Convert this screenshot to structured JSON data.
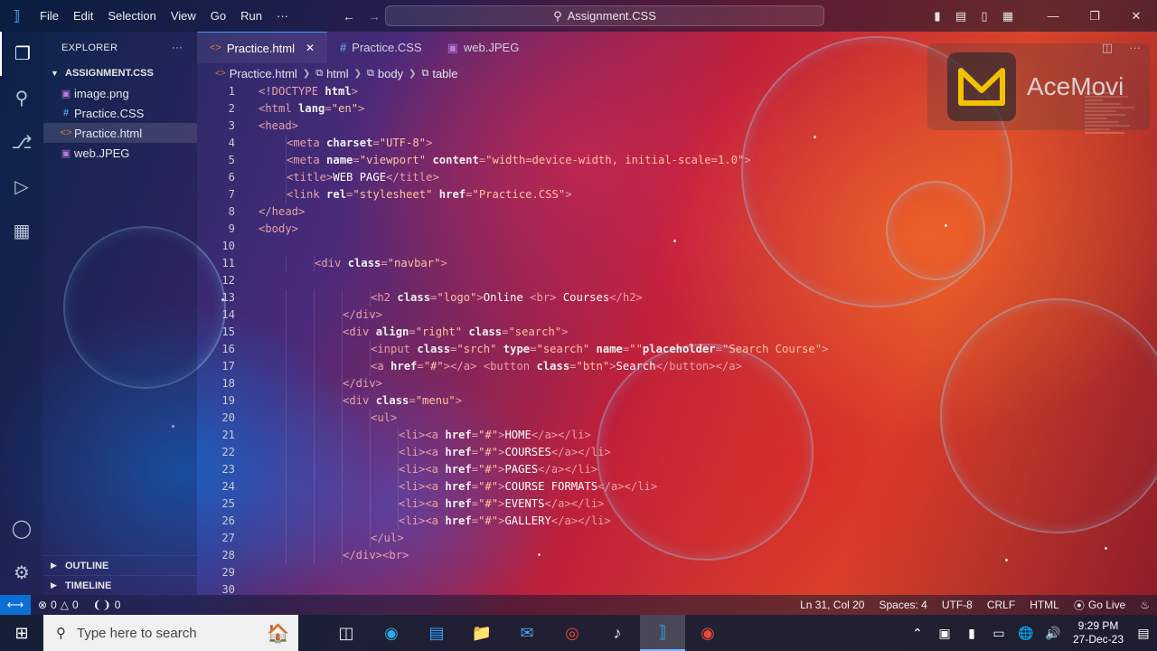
{
  "titlebar": {
    "menu": [
      "File",
      "Edit",
      "Selection",
      "View",
      "Go",
      "Run",
      "···"
    ],
    "search_text": "Assignment.CSS"
  },
  "sidebar": {
    "header": "EXPLORER",
    "more": "···",
    "folder": "ASSIGNMENT.CSS",
    "files": [
      {
        "name": "image.png",
        "icon": "image-file-icon"
      },
      {
        "name": "Practice.CSS",
        "icon": "css-file-icon"
      },
      {
        "name": "Practice.html",
        "icon": "html-file-icon"
      },
      {
        "name": "web.JPEG",
        "icon": "image-file-icon"
      }
    ],
    "outline": "OUTLINE",
    "timeline": "TIMELINE"
  },
  "tabs": [
    {
      "label": "Practice.html",
      "active": true
    },
    {
      "label": "Practice.CSS",
      "active": false
    },
    {
      "label": "web.JPEG",
      "active": false
    }
  ],
  "breadcrumb": [
    "Practice.html",
    "html",
    "body",
    "table"
  ],
  "code_lines": [
    {
      "n": "1",
      "indent": 0,
      "tokens": [
        [
          "tag",
          "<!DOCTYPE "
        ],
        [
          "attr",
          "html"
        ],
        [
          "tag",
          ">"
        ]
      ]
    },
    {
      "n": "2",
      "indent": 0,
      "tokens": [
        [
          "tag",
          "<html "
        ],
        [
          "attr",
          "lang"
        ],
        [
          "tag",
          "="
        ],
        [
          "str",
          "\"en\""
        ],
        [
          "tag",
          ">"
        ]
      ]
    },
    {
      "n": "3",
      "indent": 0,
      "tokens": [
        [
          "tag",
          "<head>"
        ]
      ]
    },
    {
      "n": "4",
      "indent": 1,
      "tokens": [
        [
          "tag",
          "<meta "
        ],
        [
          "attr",
          "charset"
        ],
        [
          "tag",
          "="
        ],
        [
          "str",
          "\"UTF-8\""
        ],
        [
          "tag",
          ">"
        ]
      ]
    },
    {
      "n": "5",
      "indent": 1,
      "tokens": [
        [
          "tag",
          "<meta "
        ],
        [
          "attr",
          "name"
        ],
        [
          "tag",
          "="
        ],
        [
          "str",
          "\"viewport\" "
        ],
        [
          "attr",
          "content"
        ],
        [
          "tag",
          "="
        ],
        [
          "str",
          "\"width=device-width, initial-scale=1.0\""
        ],
        [
          "tag",
          ">"
        ]
      ]
    },
    {
      "n": "6",
      "indent": 1,
      "tokens": [
        [
          "tag",
          "<title>"
        ],
        [
          "txt",
          "WEB PAGE"
        ],
        [
          "tag",
          "</title>"
        ]
      ]
    },
    {
      "n": "7",
      "indent": 1,
      "tokens": [
        [
          "tag",
          "<link "
        ],
        [
          "attr",
          "rel"
        ],
        [
          "tag",
          "="
        ],
        [
          "str",
          "\"stylesheet\" "
        ],
        [
          "attr",
          "href"
        ],
        [
          "tag",
          "="
        ],
        [
          "str",
          "\"Practice.CSS\""
        ],
        [
          "tag",
          ">"
        ]
      ]
    },
    {
      "n": "8",
      "indent": 0,
      "tokens": [
        [
          "tag",
          "</head>"
        ]
      ]
    },
    {
      "n": "9",
      "indent": 0,
      "tokens": [
        [
          "tag",
          "<body>"
        ]
      ]
    },
    {
      "n": "10",
      "indent": 0,
      "tokens": []
    },
    {
      "n": "11",
      "indent": 2,
      "tokens": [
        [
          "tag",
          "<div "
        ],
        [
          "attr",
          "class"
        ],
        [
          "tag",
          "="
        ],
        [
          "str",
          "\"navbar\""
        ],
        [
          "tag",
          ">"
        ]
      ]
    },
    {
      "n": "12",
      "indent": 0,
      "tokens": []
    },
    {
      "n": "13",
      "indent": 4,
      "tokens": [
        [
          "tag",
          "<h2 "
        ],
        [
          "attr",
          "class"
        ],
        [
          "tag",
          "="
        ],
        [
          "str",
          "\"logo\""
        ],
        [
          "tag",
          ">"
        ],
        [
          "txt",
          "Online "
        ],
        [
          "tag",
          "<br> "
        ],
        [
          "txt",
          "Courses"
        ],
        [
          "tag",
          "</h2>"
        ]
      ]
    },
    {
      "n": "14",
      "indent": 3,
      "tokens": [
        [
          "tag",
          "</div>"
        ]
      ]
    },
    {
      "n": "15",
      "indent": 3,
      "tokens": [
        [
          "tag",
          "<div "
        ],
        [
          "attr",
          "align"
        ],
        [
          "tag",
          "="
        ],
        [
          "str",
          "\"right\" "
        ],
        [
          "attr",
          "class"
        ],
        [
          "tag",
          "="
        ],
        [
          "str",
          "\"search\""
        ],
        [
          "tag",
          ">"
        ]
      ]
    },
    {
      "n": "16",
      "indent": 4,
      "tokens": [
        [
          "tag",
          "<input "
        ],
        [
          "attr",
          "class"
        ],
        [
          "tag",
          "="
        ],
        [
          "str",
          "\"srch\" "
        ],
        [
          "attr",
          "type"
        ],
        [
          "tag",
          "="
        ],
        [
          "str",
          "\"search\" "
        ],
        [
          "attr",
          "name"
        ],
        [
          "tag",
          "="
        ],
        [
          "str",
          "\"\""
        ],
        [
          "attr",
          "placeholder"
        ],
        [
          "tag",
          "="
        ],
        [
          "str",
          "\"Search Course\""
        ],
        [
          "tag",
          ">"
        ]
      ]
    },
    {
      "n": "17",
      "indent": 4,
      "tokens": [
        [
          "tag",
          "<a "
        ],
        [
          "attr",
          "href"
        ],
        [
          "tag",
          "="
        ],
        [
          "str",
          "\"#\""
        ],
        [
          "tag",
          "></a> <button "
        ],
        [
          "attr",
          "class"
        ],
        [
          "tag",
          "="
        ],
        [
          "str",
          "\"btn\""
        ],
        [
          "tag",
          ">"
        ],
        [
          "txt",
          "Search"
        ],
        [
          "tag",
          "</button></a>"
        ]
      ]
    },
    {
      "n": "18",
      "indent": 3,
      "tokens": [
        [
          "tag",
          "</div>"
        ]
      ]
    },
    {
      "n": "19",
      "indent": 3,
      "tokens": [
        [
          "tag",
          "<div "
        ],
        [
          "attr",
          "class"
        ],
        [
          "tag",
          "="
        ],
        [
          "str",
          "\"menu\""
        ],
        [
          "tag",
          ">"
        ]
      ]
    },
    {
      "n": "20",
      "indent": 4,
      "tokens": [
        [
          "tag",
          "<ul>"
        ]
      ]
    },
    {
      "n": "21",
      "indent": 5,
      "tokens": [
        [
          "tag",
          "<li><a "
        ],
        [
          "attr",
          "href"
        ],
        [
          "tag",
          "="
        ],
        [
          "str",
          "\"#\""
        ],
        [
          "tag",
          ">"
        ],
        [
          "txt",
          "HOME"
        ],
        [
          "tag",
          "</a></li>"
        ]
      ]
    },
    {
      "n": "22",
      "indent": 5,
      "tokens": [
        [
          "tag",
          "<li><a "
        ],
        [
          "attr",
          "href"
        ],
        [
          "tag",
          "="
        ],
        [
          "str",
          "\"#\""
        ],
        [
          "tag",
          ">"
        ],
        [
          "txt",
          "COURSES"
        ],
        [
          "tag",
          "</a></li>"
        ]
      ]
    },
    {
      "n": "23",
      "indent": 5,
      "tokens": [
        [
          "tag",
          "<li><a "
        ],
        [
          "attr",
          "href"
        ],
        [
          "tag",
          "="
        ],
        [
          "str",
          "\"#\""
        ],
        [
          "tag",
          ">"
        ],
        [
          "txt",
          "PAGES"
        ],
        [
          "tag",
          "</a></li>"
        ]
      ]
    },
    {
      "n": "24",
      "indent": 5,
      "tokens": [
        [
          "tag",
          "<li><a "
        ],
        [
          "attr",
          "href"
        ],
        [
          "tag",
          "="
        ],
        [
          "str",
          "\"#\""
        ],
        [
          "tag",
          ">"
        ],
        [
          "txt",
          "COURSE FORMATS"
        ],
        [
          "tag",
          "</a></li>"
        ]
      ]
    },
    {
      "n": "25",
      "indent": 5,
      "tokens": [
        [
          "tag",
          "<li><a "
        ],
        [
          "attr",
          "href"
        ],
        [
          "tag",
          "="
        ],
        [
          "str",
          "\"#\""
        ],
        [
          "tag",
          ">"
        ],
        [
          "txt",
          "EVENTS"
        ],
        [
          "tag",
          "</a></li>"
        ]
      ]
    },
    {
      "n": "26",
      "indent": 5,
      "tokens": [
        [
          "tag",
          "<li><a "
        ],
        [
          "attr",
          "href"
        ],
        [
          "tag",
          "="
        ],
        [
          "str",
          "\"#\""
        ],
        [
          "tag",
          ">"
        ],
        [
          "txt",
          "GALLERY"
        ],
        [
          "tag",
          "</a></li>"
        ]
      ]
    },
    {
      "n": "27",
      "indent": 4,
      "tokens": [
        [
          "tag",
          "</ul>"
        ]
      ]
    },
    {
      "n": "28",
      "indent": 3,
      "tokens": [
        [
          "tag",
          "</div><br>"
        ]
      ]
    },
    {
      "n": "29",
      "indent": 0,
      "tokens": []
    },
    {
      "n": "30",
      "indent": 0,
      "tokens": []
    }
  ],
  "watermark": "AceMovi",
  "statusbar": {
    "errors": "0",
    "warnings": "0",
    "ports": "0",
    "position": "Ln 31, Col 20",
    "spaces": "Spaces: 4",
    "encoding": "UTF-8",
    "eol": "CRLF",
    "language": "HTML",
    "golive": "Go Live"
  },
  "taskbar": {
    "search_placeholder": "Type here to search",
    "time": "9:29 PM",
    "date": "27-Dec-23"
  },
  "colors": {
    "accent": "#3aa0ff",
    "remote_badge": "#0c6fd6"
  }
}
